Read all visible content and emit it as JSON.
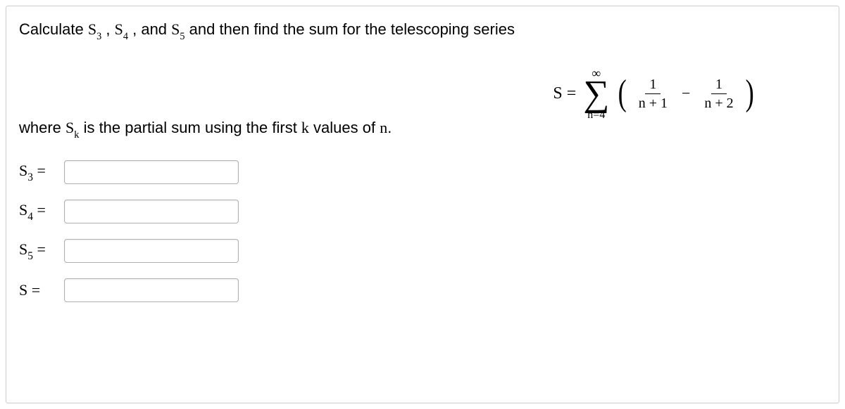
{
  "instruction": {
    "pre": "Calculate ",
    "s3": "S",
    "s3_sub": "3",
    "comma1": " , ",
    "s4": "S",
    "s4_sub": "4",
    "comma2": " , and ",
    "s5": "S",
    "s5_sub": "5",
    "post": "  and then find the sum for the telescoping series"
  },
  "formula": {
    "lhs": "S =",
    "upper": "∞",
    "lower": "n=4",
    "frac1_num": "1",
    "frac1_den": "n + 1",
    "minus": "−",
    "frac2_num": "1",
    "frac2_den": "n + 2"
  },
  "explain": {
    "pre": "where ",
    "sk": "S",
    "sk_sub": "k",
    "mid": " is the partial sum using the first ",
    "k": "k",
    "mid2": " values of ",
    "n": "n",
    "end": "."
  },
  "rows": {
    "s3_label": "S",
    "s3_sub": "3",
    "s4_label": "S",
    "s4_sub": "4",
    "s5_label": "S",
    "s5_sub": "5",
    "s_label": "S",
    "eq": " ="
  },
  "values": {
    "s3": "",
    "s4": "",
    "s5": "",
    "s": ""
  }
}
